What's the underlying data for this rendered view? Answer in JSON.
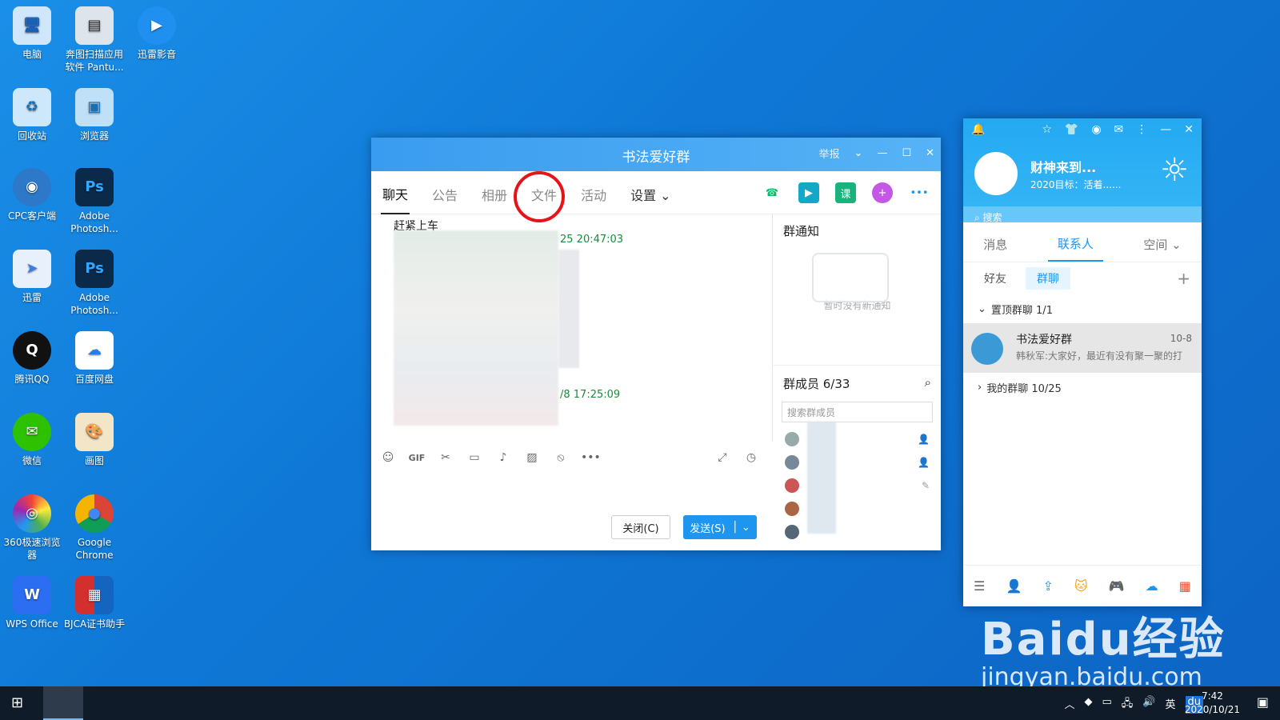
{
  "desktop": {
    "icons": [
      {
        "label": "电脑",
        "glyph": "🖥"
      },
      {
        "label": "奔图扫描应用软件 Pantu...",
        "glyph": "▤"
      },
      {
        "label": "迅雷影音",
        "glyph": "▶"
      },
      {
        "label": "回收站",
        "glyph": "♻"
      },
      {
        "label": "浏览器",
        "glyph": "▣"
      },
      {
        "label": "CPC客户端",
        "glyph": "◉"
      },
      {
        "label": "Adobe Photosh...",
        "glyph": "Ps"
      },
      {
        "label": "迅雷",
        "glyph": "➤"
      },
      {
        "label": "Adobe Photosh...",
        "glyph": "Ps"
      },
      {
        "label": "腾讯QQ",
        "glyph": "Q"
      },
      {
        "label": "百度网盘",
        "glyph": "☁"
      },
      {
        "label": "微信",
        "glyph": "✉"
      },
      {
        "label": "画图",
        "glyph": "🎨"
      },
      {
        "label": "360极速浏览器",
        "glyph": "◎"
      },
      {
        "label": "Google Chrome",
        "glyph": "●"
      },
      {
        "label": "WPS Office",
        "glyph": "W"
      },
      {
        "label": "BJCA证书助手",
        "glyph": "▦"
      }
    ]
  },
  "chat_window": {
    "title": "书法爱好群",
    "report_label": "举报",
    "tabs": [
      "聊天",
      "公告",
      "相册",
      "文件",
      "活动",
      "设置"
    ],
    "tab_icons": [
      "phone-icon",
      "video-icon",
      "class-icon",
      "add-app-icon",
      "more-icon"
    ],
    "tab_icon_labels": [
      "☎",
      "▶",
      "课",
      "+",
      "•••"
    ],
    "message_label": "赶紧上车",
    "time1": "25 20:47:03",
    "time2": "/8 17:25:09",
    "toolbar_icons": [
      "☺",
      "GIF",
      "✂",
      "▭",
      "♪",
      "▨",
      "⦸",
      "•••"
    ],
    "close_label": "关闭(C)",
    "send_label": "发送(S)",
    "notice_title": "群通知",
    "notice_empty": "暂时没有新通知",
    "members_title": "群成员 6/33",
    "member_search_placeholder": "搜索群成员"
  },
  "contacts": {
    "name": "财神来到...",
    "signature": "2020目标：活着......",
    "search_placeholder": "搜索",
    "tabs": [
      "消息",
      "联系人",
      "空间"
    ],
    "subtabs": [
      "好友",
      "群聊"
    ],
    "pinned_section": "置顶群聊 1/1",
    "group_name": "书法爱好群",
    "group_date": "10-8",
    "group_preview": "韩秋军:大家好，最近有没有聚一聚的打",
    "my_groups_section": "我的群聊 10/25"
  },
  "taskbar": {
    "input_lang": "英",
    "time": "7:42",
    "date": "2020/10/21"
  },
  "watermark": {
    "brand": "Baidu经验",
    "url": "jingyan.baidu.com"
  }
}
